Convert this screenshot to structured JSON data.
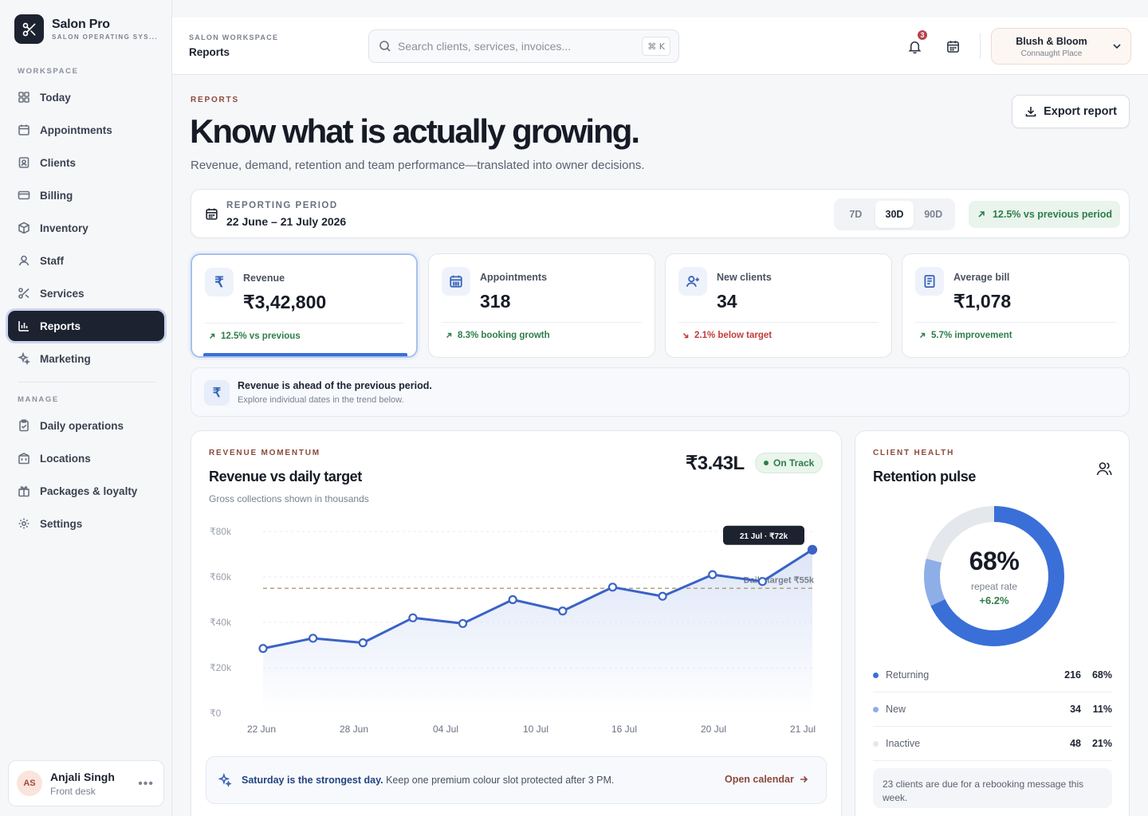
{
  "brand": {
    "name": "Salon Pro",
    "tagline": "SALON OPERATING SYS..."
  },
  "sidebar": {
    "workspace_heading": "WORKSPACE",
    "manage_heading": "MANAGE",
    "workspace_items": [
      {
        "label": "Today",
        "icon": "grid-icon"
      },
      {
        "label": "Appointments",
        "icon": "calendar-icon"
      },
      {
        "label": "Clients",
        "icon": "contact-icon"
      },
      {
        "label": "Billing",
        "icon": "card-icon"
      },
      {
        "label": "Inventory",
        "icon": "box-icon"
      },
      {
        "label": "Staff",
        "icon": "user-icon"
      },
      {
        "label": "Services",
        "icon": "scissors-icon"
      },
      {
        "label": "Reports",
        "icon": "bar-chart-icon",
        "active": true
      },
      {
        "label": "Marketing",
        "icon": "sparkle-icon"
      }
    ],
    "manage_items": [
      {
        "label": "Daily operations",
        "icon": "clipboard-icon"
      },
      {
        "label": "Locations",
        "icon": "building-icon"
      },
      {
        "label": "Packages & loyalty",
        "icon": "gift-icon"
      },
      {
        "label": "Settings",
        "icon": "gear-icon"
      }
    ],
    "user": {
      "initials": "AS",
      "name": "Anjali Singh",
      "role": "Front desk"
    }
  },
  "topbar": {
    "crumb_small": "SALON WORKSPACE",
    "crumb_title": "Reports",
    "search_placeholder": "Search clients, services, invoices...",
    "search_shortcut": "⌘ K",
    "notification_count": "3",
    "workspace": {
      "name": "Blush & Bloom",
      "location": "Connaught Place"
    }
  },
  "header": {
    "eyebrow": "REPORTS",
    "title": "Know what is actually growing.",
    "subtitle": "Revenue, demand, retention and team performance—translated into owner decisions.",
    "export_label": "Export report"
  },
  "period": {
    "label": "REPORTING PERIOD",
    "value": "22 June – 21 July 2026",
    "options": [
      "7D",
      "30D",
      "90D"
    ],
    "selected": "30D",
    "delta": "12.5% vs previous period"
  },
  "kpis": [
    {
      "label": "Revenue",
      "value": "₹3,42,800",
      "delta": "12.5% vs previous",
      "trend": "up",
      "icon": "rupee-icon",
      "glyph": "₹",
      "active": true
    },
    {
      "label": "Appointments",
      "value": "318",
      "delta": "8.3% booking growth",
      "trend": "up",
      "icon": "calendar-icon"
    },
    {
      "label": "New clients",
      "value": "34",
      "delta": "2.1% below target",
      "trend": "down",
      "icon": "user-plus-icon"
    },
    {
      "label": "Average bill",
      "value": "₹1,078",
      "delta": "5.7% improvement",
      "trend": "up",
      "icon": "receipt-icon"
    }
  ],
  "insight": {
    "glyph": "₹",
    "title": "Revenue is ahead of the previous period.",
    "subtitle": "Explore individual dates in the trend below."
  },
  "revenue_card": {
    "eyebrow": "REVENUE MOMENTUM",
    "title": "Revenue vs daily target",
    "subtitle": "Gross collections shown in thousands",
    "total": "₹3.43L",
    "status": "On Track",
    "tooltip": "21 Jul · ₹72k",
    "target_label": "Daily target ₹55k",
    "tip_bold": "Saturday is the strongest day.",
    "tip_rest": " Keep one premium colour slot protected after 3 PM.",
    "tip_link": "Open calendar"
  },
  "chart_data": {
    "type": "line",
    "title": "Revenue vs daily target",
    "subtitle": "Gross collections shown in thousands",
    "x_ticks": [
      "22 Jun",
      "28 Jun",
      "04 Jul",
      "10 Jul",
      "16 Jul",
      "20 Jul",
      "21 Jul"
    ],
    "y_ticks": [
      "₹0",
      "₹20k",
      "₹40k",
      "₹60k",
      "₹80k"
    ],
    "ylim": [
      0,
      80
    ],
    "x": [
      "22 Jun",
      "24 Jun",
      "26 Jun",
      "28 Jun",
      "30 Jun",
      "02 Jul",
      "04 Jul",
      "06 Jul",
      "08 Jul",
      "10 Jul",
      "12 Jul",
      "14 Jul",
      "16 Jul",
      "18 Jul",
      "20 Jul",
      "21 Jul"
    ],
    "series": [
      {
        "values": [
          28.5,
          33,
          31,
          42,
          39.5,
          50,
          45,
          55.5,
          51.5,
          61,
          58,
          72
        ]
      }
    ],
    "series_points_x_index": [
      0,
      2.2,
      4.4,
      6.6,
      8.8,
      11,
      13.2,
      15.4,
      17.6,
      19.8,
      22,
      24.2
    ],
    "target": 55,
    "grid": true,
    "colors": {
      "line": "#3a63c4",
      "target": "#a8935e",
      "area": "#dbe4f7"
    }
  },
  "retention": {
    "eyebrow": "CLIENT HEALTH",
    "title": "Retention pulse",
    "center_value": "68%",
    "center_label": "repeat rate",
    "center_delta": "+6.2%",
    "segments": [
      {
        "name": "Returning",
        "count": "216",
        "pct": "68%",
        "value": 68,
        "color": "#3a6fd8"
      },
      {
        "name": "New",
        "count": "34",
        "pct": "11%",
        "value": 11,
        "color": "#8eaee8"
      },
      {
        "name": "Inactive",
        "count": "48",
        "pct": "21%",
        "value": 21,
        "color": "#e4e7ec"
      }
    ],
    "note": "23 clients are due for a rebooking message this week."
  }
}
